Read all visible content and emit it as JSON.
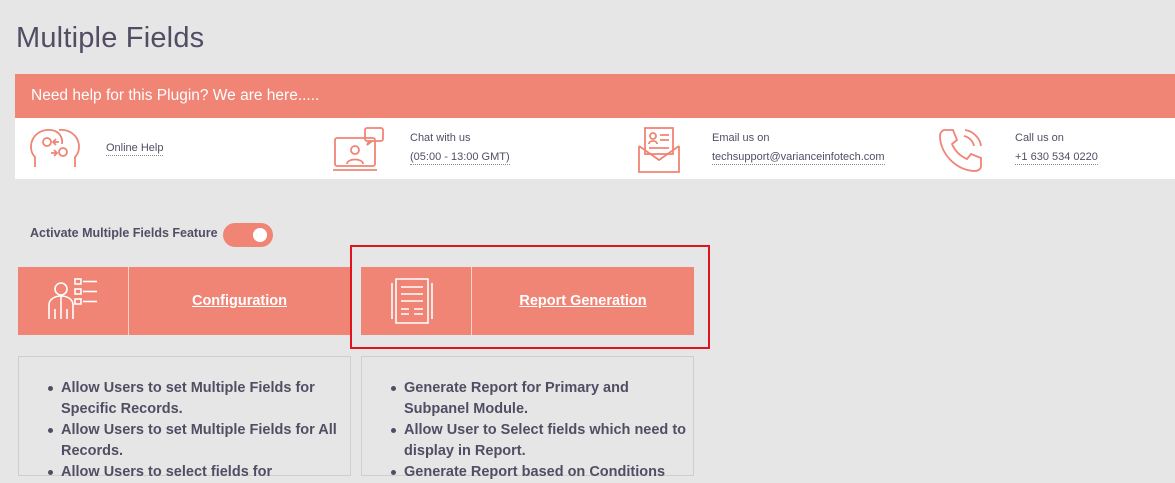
{
  "page": {
    "title": "Multiple Fields"
  },
  "help": {
    "banner": "Need help for this Plugin? We are here.....",
    "online_help": "Online Help",
    "chat_label": "Chat with us",
    "chat_hours": "(05:00 - 13:00 GMT)",
    "email_label": "Email us on",
    "email_value": "techsupport@varianceinfotech.com",
    "call_label": "Call us on",
    "call_value": "+1 630 534 0220"
  },
  "feature_toggle": {
    "label": "Activate Multiple Fields Feature",
    "enabled": true
  },
  "cards": [
    {
      "title": "Configuration",
      "icon": "user-fields-icon",
      "bullets": [
        "Allow Users to set Multiple Fields for Specific Records.",
        "Allow Users to set Multiple Fields for All Records.",
        "Allow Users to select fields for"
      ]
    },
    {
      "title": "Report Generation",
      "icon": "report-document-icon",
      "bullets": [
        "Generate Report for Primary and Subpanel Module.",
        "Allow User to Select fields which need to display in Report.",
        "Generate Report based on Conditions"
      ]
    }
  ],
  "colors": {
    "accent": "#f08475",
    "text": "#534d64",
    "highlight": "#e0141e",
    "background": "#e6e6e6"
  }
}
